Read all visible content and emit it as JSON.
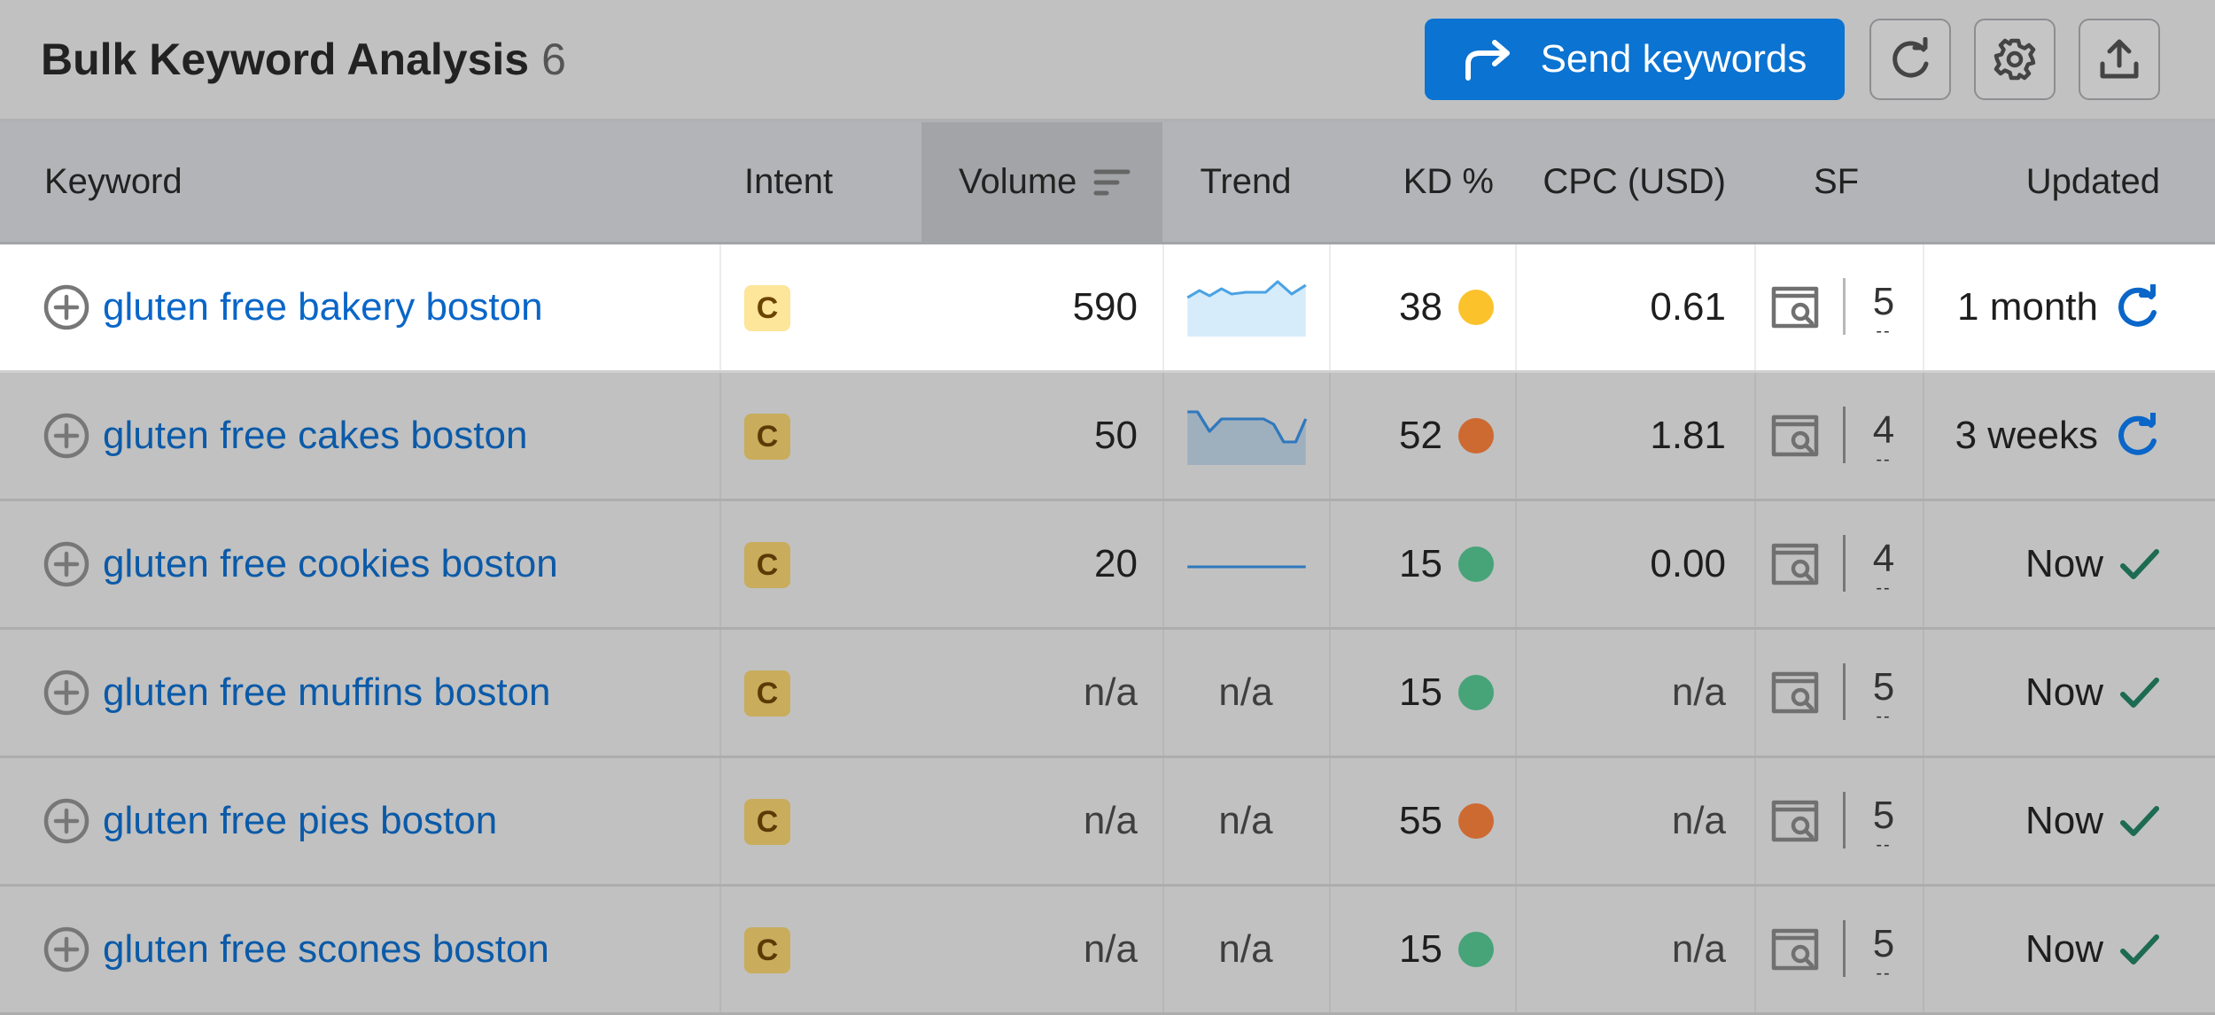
{
  "header": {
    "title": "Bulk Keyword Analysis",
    "count": "6",
    "send_label": "Send keywords",
    "icons": [
      "share-arrow-icon",
      "refresh-icon",
      "gear-icon",
      "export-icon"
    ]
  },
  "columns": {
    "keyword": "Keyword",
    "intent": "Intent",
    "volume": "Volume",
    "trend": "Trend",
    "kd": "KD %",
    "cpc": "CPC (USD)",
    "sf": "SF",
    "updated": "Updated"
  },
  "colors": {
    "accent": "#0b73d1",
    "kd_yellow": "#fbc22c",
    "kd_orange": "#cd6a32",
    "kd_green": "#47a378",
    "check_green": "#1d6b52",
    "refresh_blue": "#0a66c8"
  },
  "rows": [
    {
      "keyword": "gluten free bakery boston",
      "intent": "C",
      "volume": "590",
      "trend_shape": "spiky",
      "kd": "38",
      "kd_color": "#fbc22c",
      "cpc": "0.61",
      "sf": "5",
      "updated": "1 month",
      "updated_icon": "refresh-icon"
    },
    {
      "keyword": "gluten free cakes boston",
      "intent": "C",
      "volume": "50",
      "trend_shape": "plateau",
      "kd": "52",
      "kd_color": "#cd6a32",
      "cpc": "1.81",
      "sf": "4",
      "updated": "3 weeks",
      "updated_icon": "refresh-icon"
    },
    {
      "keyword": "gluten free cookies boston",
      "intent": "C",
      "volume": "20",
      "trend_shape": "flat",
      "kd": "15",
      "kd_color": "#47a378",
      "cpc": "0.00",
      "sf": "4",
      "updated": "Now",
      "updated_icon": "check-icon"
    },
    {
      "keyword": "gluten free muffins boston",
      "intent": "C",
      "volume": "n/a",
      "trend": "n/a",
      "kd": "15",
      "kd_color": "#47a378",
      "cpc": "n/a",
      "sf": "5",
      "updated": "Now",
      "updated_icon": "check-icon"
    },
    {
      "keyword": "gluten free pies boston",
      "intent": "C",
      "volume": "n/a",
      "trend": "n/a",
      "kd": "55",
      "kd_color": "#cd6a32",
      "cpc": "n/a",
      "sf": "5",
      "updated": "Now",
      "updated_icon": "check-icon"
    },
    {
      "keyword": "gluten free scones boston",
      "intent": "C",
      "volume": "n/a",
      "trend": "n/a",
      "kd": "15",
      "kd_color": "#47a378",
      "cpc": "n/a",
      "sf": "5",
      "updated": "Now",
      "updated_icon": "check-icon"
    }
  ]
}
